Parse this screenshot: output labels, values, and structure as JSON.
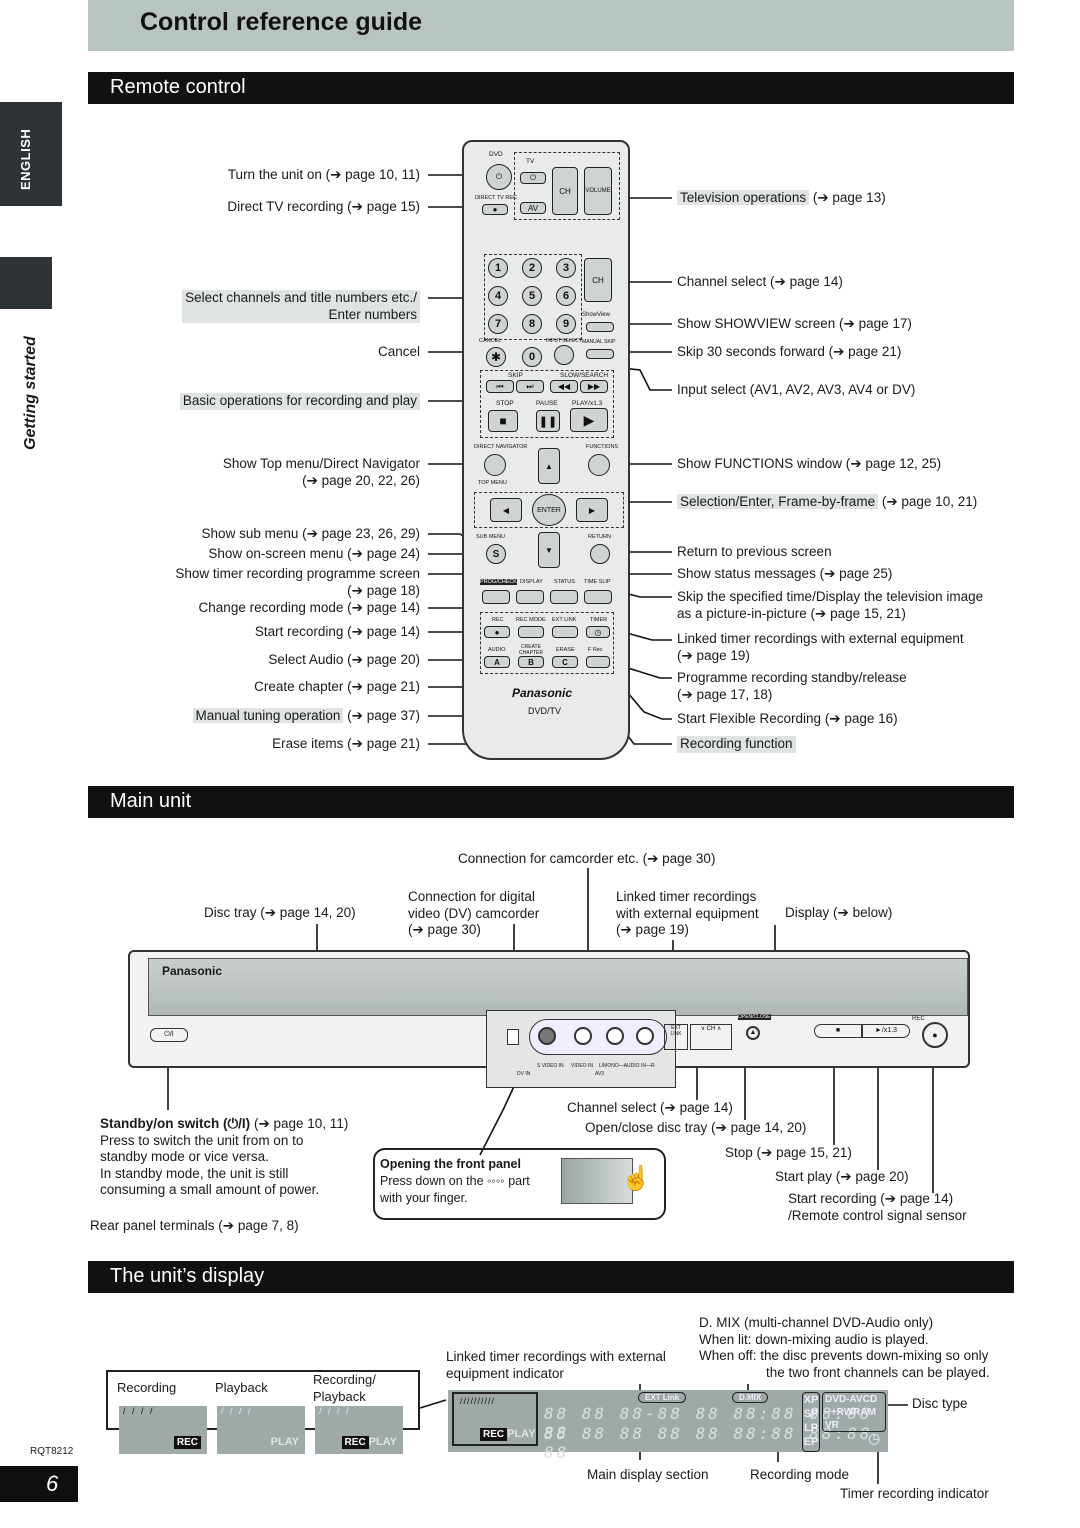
{
  "page": {
    "title": "Control reference guide",
    "side_tab_language": "ENGLISH",
    "side_tab_section": "Getting started",
    "doc_code": "RQT8212",
    "page_number": "6"
  },
  "sections": {
    "remote": "Remote control",
    "main_unit": "Main unit",
    "display": "The unit’s display"
  },
  "remote": {
    "left_labels": [
      {
        "text": "Turn the unit on (➔ page 10, 11)"
      },
      {
        "text": "Direct TV recording (➔ page 15)"
      },
      {
        "text": "Select channels and title numbers etc./",
        "text2": "Enter numbers",
        "highlight": true
      },
      {
        "text": "Cancel"
      },
      {
        "text": "Basic operations for recording and play",
        "highlight": true
      },
      {
        "text": "Show Top menu/Direct Navigator",
        "text2": "(➔ page 20, 22, 26)"
      },
      {
        "text": "Show sub menu (➔ page 23, 26, 29)"
      },
      {
        "text": "Show on-screen menu (➔ page 24)"
      },
      {
        "text": "Show timer recording programme screen",
        "text2": "(➔ page 18)"
      },
      {
        "text": "Change recording mode (➔ page 14)"
      },
      {
        "text": "Start recording (➔ page 14)"
      },
      {
        "text": "Select Audio (➔ page 20)"
      },
      {
        "text": "Create chapter (➔ page 21)"
      },
      {
        "text": "Manual tuning operation",
        "suffix": "(➔ page 37)",
        "highlight": true
      },
      {
        "text": "Erase items (➔ page 21)"
      }
    ],
    "right_labels": [
      {
        "text": "Television operations",
        "suffix": "(➔ page 13)",
        "highlight": true
      },
      {
        "text": "Channel select (➔ page 14)"
      },
      {
        "text": "Show SHOWVIEW screen (➔ page 17)"
      },
      {
        "text": "Skip 30 seconds forward (➔ page 21)"
      },
      {
        "text": "Input select (AV1, AV2, AV3, AV4 or DV)"
      },
      {
        "text": "Show FUNCTIONS window (➔ page 12, 25)"
      },
      {
        "text": "Selection/Enter, Frame-by-frame",
        "suffix": "(➔ page 10, 21)",
        "highlight": true
      },
      {
        "text": "Return to previous screen"
      },
      {
        "text": "Show status messages (➔ page 25)"
      },
      {
        "text": "Skip the specified time/Display the television image",
        "text2": "as a picture-in-picture (➔ page 15, 21)"
      },
      {
        "text": "Linked timer recordings with external equipment",
        "text2": "(➔ page 19)"
      },
      {
        "text": "Programme recording standby/release",
        "text2": "(➔ page 17, 18)"
      },
      {
        "text": "Start Flexible Recording (➔ page 16)"
      },
      {
        "text": "Recording function",
        "highlight": true
      }
    ],
    "buttons": {
      "dvd": "DVD",
      "tv": "TV",
      "direct_tv_rec": "DIRECT TV REC",
      "av": "AV",
      "ch": "CH",
      "volume": "VOLUME",
      "digits": [
        "1",
        "2",
        "3",
        "4",
        "5",
        "6",
        "7",
        "8",
        "9",
        "0"
      ],
      "cancel": "CANCEL",
      "cancel_glyph": "✱",
      "showview": "ShowView",
      "input_select": "INPUT SELECT",
      "manual_skip": "MANUAL SKIP",
      "skip": "SKIP",
      "slow_search": "SLOW/SEARCH",
      "stop": "STOP",
      "pause": "PAUSE",
      "play": "PLAY/x1.3",
      "direct_navigator": "DIRECT NAVIGATOR",
      "top_menu": "TOP MENU",
      "functions": "FUNCTIONS",
      "enter": "ENTER",
      "sub_menu": "SUB MENU",
      "sub_menu_glyph": "S",
      "return": "RETURN",
      "prog_check": "PROG/CHECK",
      "display": "DISPLAY",
      "status": "STATUS",
      "time_slip": "TIME SLIP",
      "rec": "REC",
      "rec_mode": "REC MODE",
      "ext_link": "EXT LINK",
      "timer": "TIMER",
      "audio": "AUDIO",
      "create_chapter": "CREATE CHAPTER",
      "erase": "ERASE",
      "f_rec": "F Rec",
      "a": "A",
      "b": "B",
      "c": "C",
      "brand": "Panasonic",
      "model": "DVD/TV"
    }
  },
  "main_unit": {
    "top_labels": {
      "camcorder": "Connection for camcorder etc.  (➔ page 30)",
      "disc_tray": "Disc tray (➔ page 14, 20)",
      "dv": [
        "Connection for digital",
        "video (DV) camcorder",
        "(➔ page 30)"
      ],
      "ext_link": [
        "Linked timer recordings",
        "with external equipment",
        "(➔ page 19)"
      ],
      "display": "Display (➔ below)"
    },
    "standby": {
      "title": "Standby/on switch (⏻/I)",
      "ref": "(➔ page 10, 11)",
      "lines": [
        "Press to switch the unit from on to",
        "standby mode or vice versa.",
        "In standby mode, the unit is still",
        "consuming a small amount of power."
      ]
    },
    "rear": "Rear panel terminals (➔ page 7, 8)",
    "front_panel_note": {
      "title": "Opening the front panel",
      "lines": [
        "Press down on the ◦◦◦◦ part",
        "with your finger."
      ]
    },
    "bottom_labels": [
      "Channel select (➔ page 14)",
      "Open/close disc tray (➔ page 14, 20)",
      "Stop (➔ page 15, 21)",
      "Start play (➔ page 20)",
      "Start recording (➔ page 14)",
      "/Remote control signal sensor"
    ],
    "device": {
      "brand": "Panasonic",
      "power": "⏻/I",
      "svideo": "S VIDEO IN",
      "video": "VIDEO IN",
      "audio": "L/MONO—AUDIO IN—R",
      "av3": "AV3",
      "dvin": "DV IN",
      "ext_link": "EXT LINK",
      "ch": "∨ CH ∧",
      "open_close": "OPEN/CLOSE",
      "stop": "■",
      "play": "►/x1.3",
      "rec": "REC"
    }
  },
  "display": {
    "modes": [
      {
        "label": "Recording",
        "badge": "REC",
        "play": ""
      },
      {
        "label": "Playback",
        "badge": "",
        "play": "PLAY"
      },
      {
        "label": "Recording/",
        "label2": "Playback",
        "badge": "REC",
        "play": "PLAY"
      }
    ],
    "annotations": {
      "ext_indicator": [
        "Linked timer recordings with external",
        "equipment indicator"
      ],
      "dmix": [
        "D. MIX (multi-channel DVD-Audio only)",
        "When lit:  down-mixing audio is played.",
        "When off: the disc prevents down-mixing so only",
        "the two front channels can be played."
      ],
      "disc_type": "Disc type",
      "main_section": "Main display section",
      "rec_mode": "Recording mode",
      "timer_indicator": "Timer recording indicator"
    },
    "vfd": {
      "rec": "REC",
      "play": "PLAY",
      "ext_link": "EXT Link",
      "dmix": "D.MIX",
      "segments_top": "88 88 88-88 88 88:88 88:88 88",
      "segments_bottom": "88 88 88 88 88 88:88 88:88 88",
      "modes": [
        "XP",
        "SP",
        "LP",
        "EP"
      ],
      "disc_row1": "DVD-AVCD",
      "disc_row2": "−+RWRAM",
      "disc_row3": "VR",
      "timer_glyph": "◷"
    }
  }
}
